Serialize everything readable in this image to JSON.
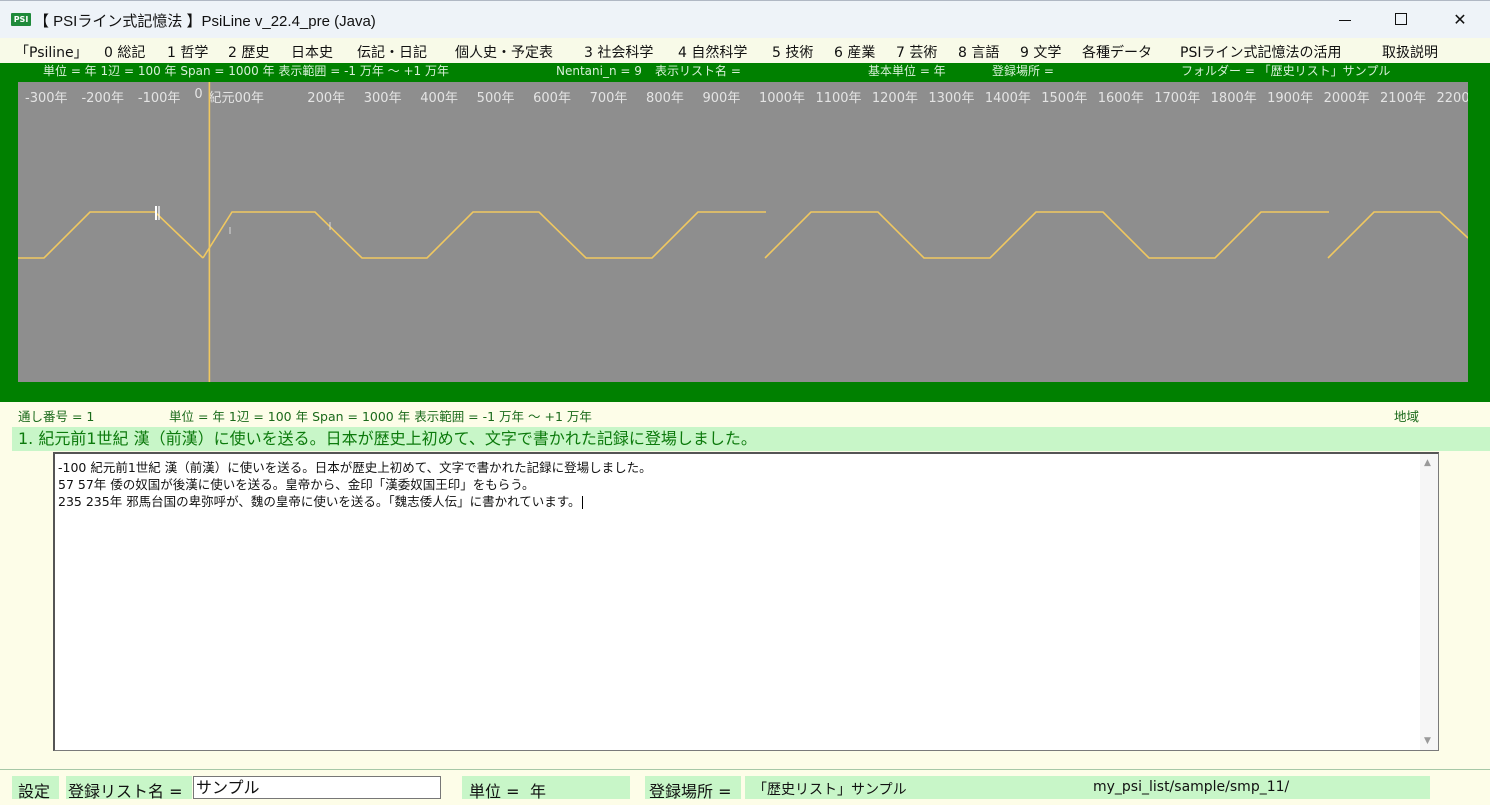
{
  "window": {
    "icon_text": "PSI",
    "title": "【 PSIライン式記憶法 】PsiLine v_22.4_pre (Java)"
  },
  "menu": [
    "「Psiline」",
    "0 総記",
    "1 哲学",
    "2 歴史",
    "日本史",
    "伝記・日記",
    "個人史・予定表",
    "3 社会科学",
    "4 自然科学",
    "5 技術",
    "6 産業",
    "7 芸術",
    "8 言語",
    "9 文学",
    "各種データ",
    "PSIライン式記憶法の活用",
    "取扱説明"
  ],
  "status_top": {
    "unit": "単位 = 年  1辺 = 100 年  Span = 1000 年  表示範囲 = -1 万年 ～ +1 万年",
    "nentani": "Nentani_n = 9",
    "list_name": "表示リスト名 =",
    "base_unit": "基本単位 = 年",
    "location": "登録場所 =",
    "folder": "フォルダー = 「歴史リスト」サンプル"
  },
  "timeline": {
    "ticks": [
      {
        "label": "-300年",
        "year": -300
      },
      {
        "label": "-200年",
        "year": -200
      },
      {
        "label": "-100年",
        "year": -100
      },
      {
        "label": "0",
        "year": 0
      },
      {
        "label": "紀元00年",
        "year": 25
      },
      {
        "label": "200年",
        "year": 200
      },
      {
        "label": "300年",
        "year": 300
      },
      {
        "label": "400年",
        "year": 400
      },
      {
        "label": "500年",
        "year": 500
      },
      {
        "label": "600年",
        "year": 600
      },
      {
        "label": "700年",
        "year": 700
      },
      {
        "label": "800年",
        "year": 800
      },
      {
        "label": "900年",
        "year": 900
      },
      {
        "label": "1000年",
        "year": 1000
      },
      {
        "label": "1100年",
        "year": 1100
      },
      {
        "label": "1200年",
        "year": 1200
      },
      {
        "label": "1300年",
        "year": 1300
      },
      {
        "label": "1400年",
        "year": 1400
      },
      {
        "label": "1500年",
        "year": 1500
      },
      {
        "label": "1600年",
        "year": 1600
      },
      {
        "label": "1700年",
        "year": 1700
      },
      {
        "label": "1800年",
        "year": 1800
      },
      {
        "label": "1900年",
        "year": 1900
      },
      {
        "label": "2000年",
        "year": 2000
      },
      {
        "label": "2100年",
        "year": 2100
      },
      {
        "label": "2200年",
        "year": 2200
      }
    ],
    "current_year": 0,
    "event_years": [
      -100,
      57,
      235
    ],
    "line_color": "#f0c860",
    "background_color": "#8e8e8e"
  },
  "info": {
    "serial": "通し番号 = 1",
    "unit": "単位 = 年  1辺 = 100 年  Span = 1000 年  表示範囲 = -1 万年 ～ +1 万年",
    "region": "地域"
  },
  "selected_event": "1. 紀元前1世紀 漢（前漢）に使いを送る。日本が歴史上初めて、文字で書かれた記録に登場しました。",
  "editor_lines": [
    "-100  紀元前1世紀 漢（前漢）に使いを送る。日本が歴史上初めて、文字で書かれた記録に登場しました。",
    "57  57年 倭の奴国が後漢に使いを送る。皇帝から、金印「漢委奴国王印」をもらう。",
    "235  235年 邪馬台国の卑弥呼が、魏の皇帝に使いを送る。「魏志倭人伝」に書かれています。"
  ],
  "bottom": {
    "settings": "設定",
    "list_name_label": "登録リスト名 =",
    "list_name_value": "サンプル",
    "unit_label": "単位 =",
    "unit_value": "年",
    "location_label": "登録場所 =",
    "location_value": "「歴史リスト」サンプル",
    "path": "my_psi_list/sample/smp_11/"
  }
}
